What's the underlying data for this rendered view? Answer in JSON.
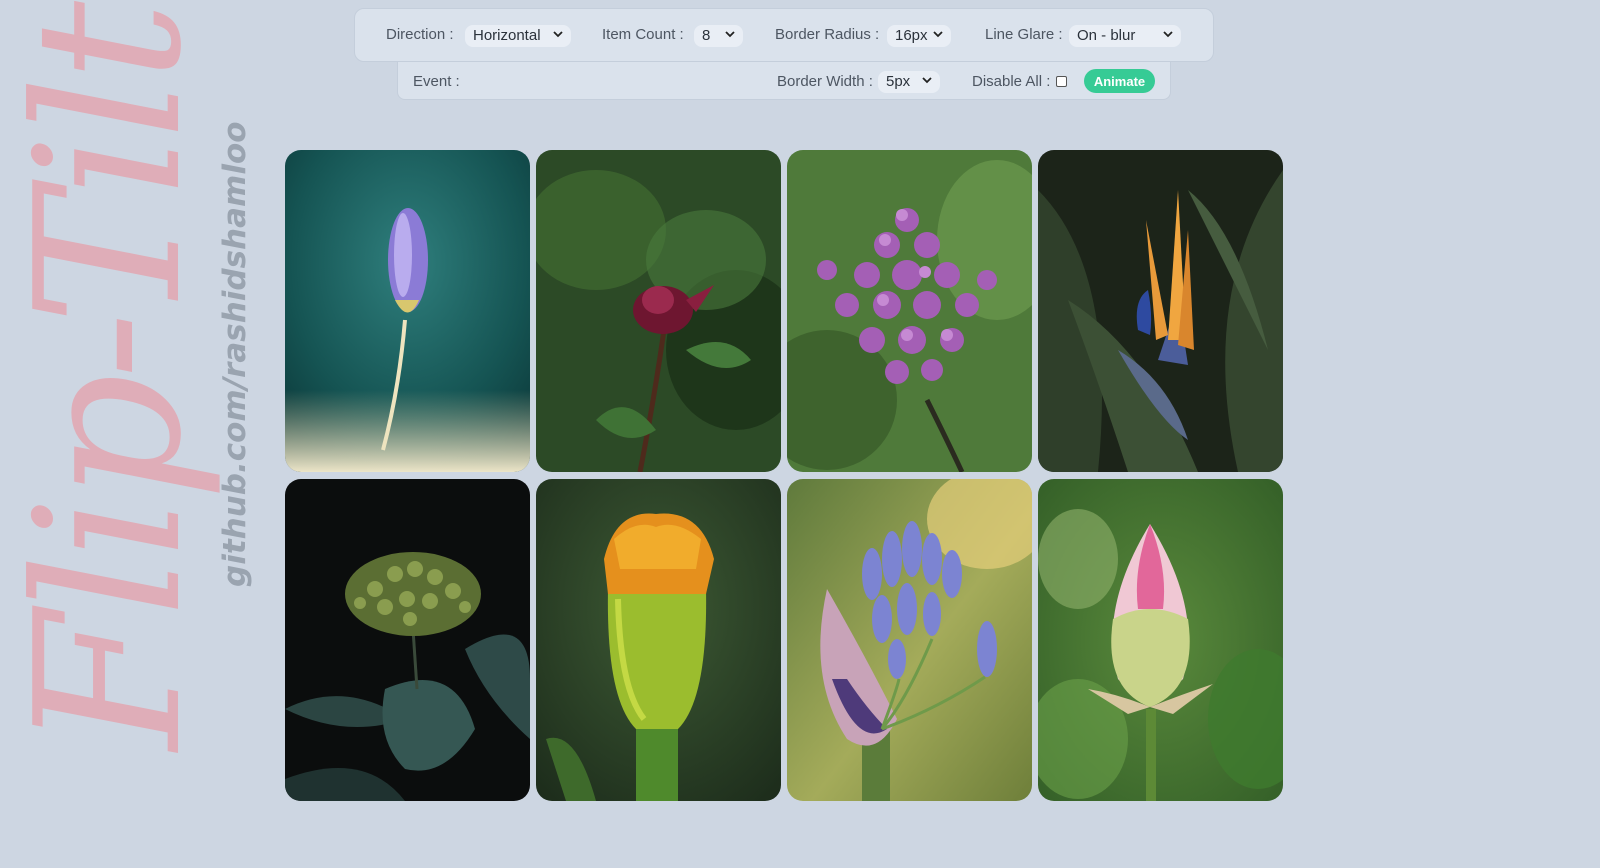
{
  "watermark": {
    "title": "Flip-Tilt",
    "url": "github.com/rashidshamloo"
  },
  "controls": {
    "direction": {
      "label": "Direction :",
      "value": "Horizontal"
    },
    "item_count": {
      "label": "Item Count :",
      "value": "8"
    },
    "border_radius": {
      "label": "Border Radius :",
      "value": "16px"
    },
    "line_glare": {
      "label": "Line Glare :",
      "value": "On - blur"
    },
    "event": {
      "label": "Event :",
      "value": ""
    },
    "border_width": {
      "label": "Border Width :",
      "value": "5px"
    },
    "disable_all": {
      "label": "Disable All :",
      "checked": false
    },
    "animate_button": {
      "label": "Animate"
    }
  },
  "colors": {
    "background": "#cdd6e2",
    "panel": "#dae2ec",
    "accent_green": "#36cb95",
    "watermark_pink": "#e3a7b1"
  },
  "gallery": {
    "items": [
      {
        "subject": "purple crocus bud on teal background"
      },
      {
        "subject": "dark red dahlia among green leaves"
      },
      {
        "subject": "pink-purple lilac cluster"
      },
      {
        "subject": "bird of paradise flower with dark leaves"
      },
      {
        "subject": "green hydrangea bud on black background"
      },
      {
        "subject": "orange marigold bud with green calyx"
      },
      {
        "subject": "blue agapanthus buds"
      },
      {
        "subject": "pink lotus bud"
      }
    ]
  }
}
